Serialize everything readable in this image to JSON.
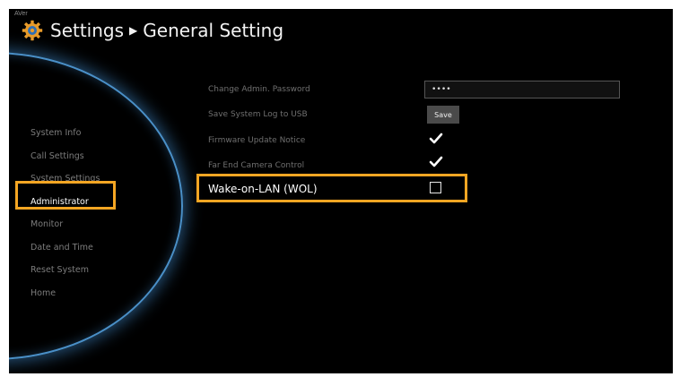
{
  "brand": "AVer",
  "header": {
    "title": "Settings",
    "separator": "▶",
    "subtitle": "General Setting"
  },
  "sidebar": {
    "items": [
      {
        "label": "System Info"
      },
      {
        "label": "Call Settings"
      },
      {
        "label": "System Settings"
      },
      {
        "label": "Administrator",
        "active": true
      },
      {
        "label": "Monitor"
      },
      {
        "label": "Date and Time"
      },
      {
        "label": "Reset System"
      },
      {
        "label": "Home"
      }
    ]
  },
  "settings": {
    "change_password_label": "Change Admin. Password",
    "password_value": "••••",
    "save_log_label": "Save System Log to USB",
    "save_button_label": "Save",
    "firmware_notice_label": "Firmware Update Notice",
    "firmware_notice_checked": true,
    "far_end_label": "Far End Camera Control",
    "far_end_checked": true,
    "wol_label": "Wake-on-LAN (WOL)",
    "wol_checked": false
  },
  "colors": {
    "highlight": "#f5a623",
    "accent_glow": "#4a90c8",
    "background": "#000000"
  },
  "icons": {
    "header": "gear-icon",
    "checked": "checkmark-icon"
  }
}
